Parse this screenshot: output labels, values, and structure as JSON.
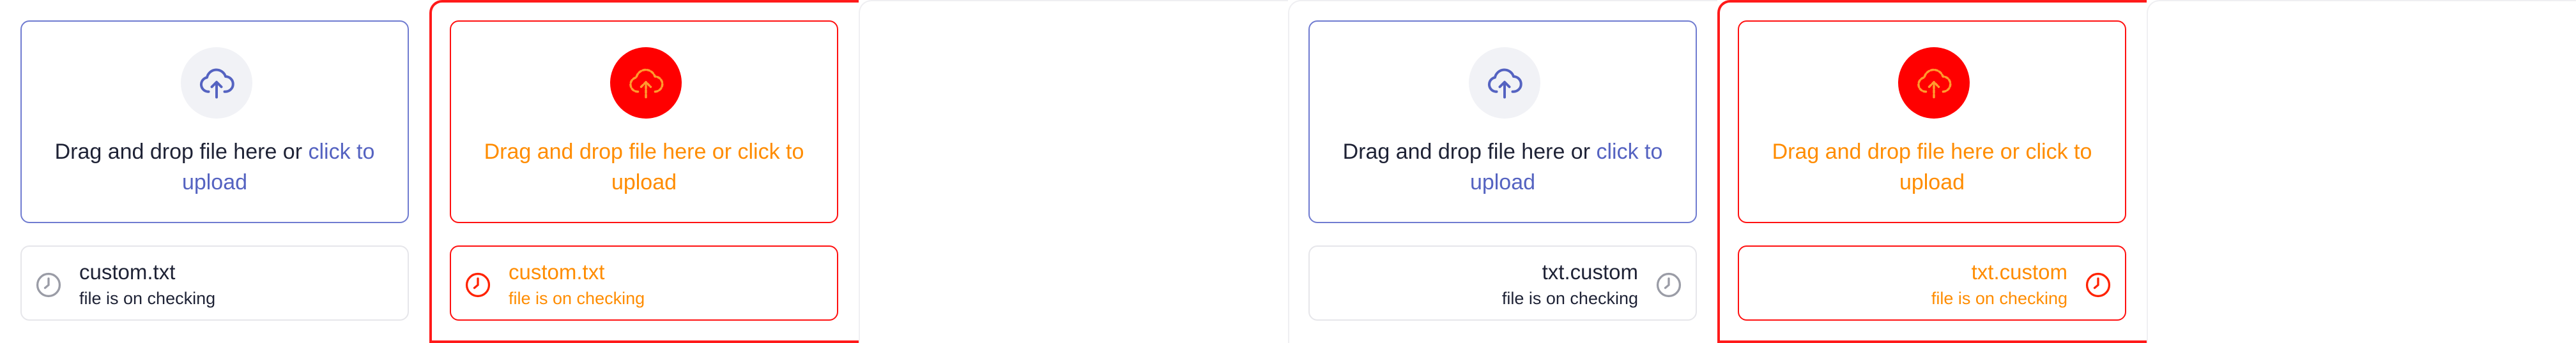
{
  "colors": {
    "accent": "#5563c1",
    "border_default": "#6f7bd0",
    "error": "#ff0000",
    "error_text": "#ff8c00",
    "text": "#1e2235"
  },
  "icons": {
    "upload": "cloud-upload-icon",
    "pending": "clock-icon"
  },
  "variants": [
    {
      "state": "default",
      "direction": "ltr",
      "dropzone": {
        "text": "Drag and drop file here or ",
        "link": "click to upload"
      },
      "file": {
        "name": "custom.txt",
        "status": "file is on checking"
      }
    },
    {
      "state": "error",
      "direction": "ltr",
      "dropzone": {
        "text": "Drag and drop file here or ",
        "link": "click to upload"
      },
      "file": {
        "name": "custom.txt",
        "status": "file is on checking"
      }
    },
    {
      "state": "default",
      "direction": "rtl",
      "dropzone": {
        "text": "Drag and drop file here or ",
        "link": "click to upload"
      },
      "file": {
        "name": "txt.custom",
        "status": "file is on checking"
      }
    },
    {
      "state": "error",
      "direction": "rtl",
      "dropzone": {
        "text": "Drag and drop file here or ",
        "link": "click to upload"
      },
      "file": {
        "name": "txt.custom",
        "status": "file is on checking"
      }
    }
  ]
}
